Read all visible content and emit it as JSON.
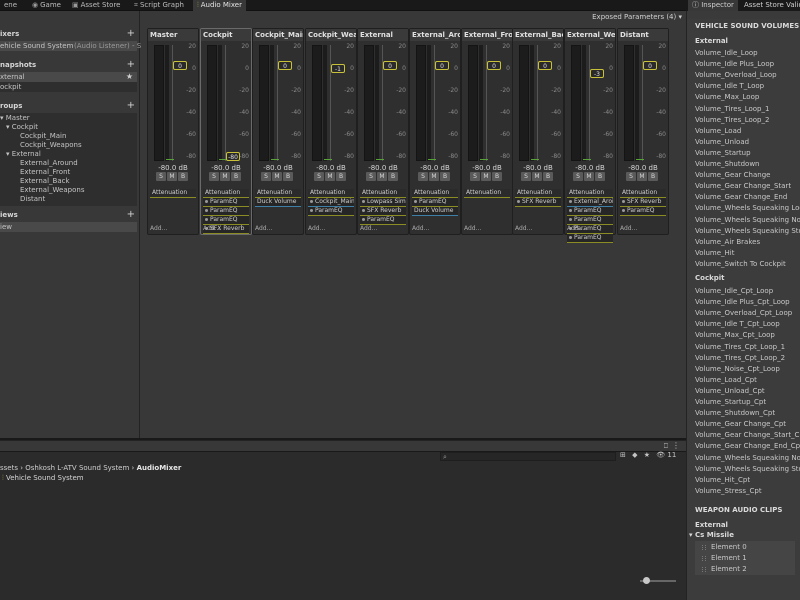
{
  "tabs": [
    {
      "label": "ene",
      "icon": ""
    },
    {
      "label": "Game",
      "icon": "gamepad-icon"
    },
    {
      "label": "Asset Store",
      "icon": "store-icon"
    },
    {
      "label": "Script Graph",
      "icon": "graph-icon"
    },
    {
      "label": "Audio Mixer",
      "icon": "audio-mixer-icon"
    }
  ],
  "right_tabs": [
    {
      "label": "Inspector",
      "icon": "info-icon"
    },
    {
      "label": "Asset Store Validat"
    }
  ],
  "exposed_parameters": "Exposed Parameters (4)",
  "left": {
    "mixers_title": "ixers",
    "mixer_name": "ehicle Sound System",
    "mixer_listener": "(Audio Listener) - S",
    "snapshots_title": "napshots",
    "snapshots": [
      "xternal",
      "ockpit"
    ],
    "groups_title": "roups",
    "groups": [
      {
        "label": "Master",
        "indent": 0
      },
      {
        "label": "Cockpit",
        "indent": 1
      },
      {
        "label": "Cockpit_Main",
        "indent": 2
      },
      {
        "label": "Cockpit_Weapons",
        "indent": 2
      },
      {
        "label": "External",
        "indent": 1
      },
      {
        "label": "External_Around",
        "indent": 2
      },
      {
        "label": "External_Front",
        "indent": 2
      },
      {
        "label": "External_Back",
        "indent": 2
      },
      {
        "label": "External_Weapons",
        "indent": 2
      },
      {
        "label": "Distant",
        "indent": 2
      }
    ],
    "views_title": "iews",
    "views": [
      "iew"
    ]
  },
  "strips": [
    {
      "name": "Master",
      "db": "-80.0 dB",
      "fader": "0",
      "effects": [
        {
          "label": "Attenuation",
          "type": "head"
        }
      ]
    },
    {
      "name": "Cockpit",
      "db": "-80.0 dB",
      "fader": "-80",
      "effects": [
        {
          "label": "Attenuation",
          "type": "head"
        },
        {
          "label": "ParamEQ",
          "type": "dot"
        },
        {
          "label": "ParamEQ",
          "type": "dot"
        },
        {
          "label": "ParamEQ",
          "type": "dot"
        },
        {
          "label": "SFX Reverb",
          "type": "dot"
        }
      ]
    },
    {
      "name": "Cockpit_Main",
      "db": "-80.0 dB",
      "fader": "0",
      "effects": [
        {
          "label": "Attenuation",
          "type": "head"
        },
        {
          "label": "Duck Volume",
          "type": "blue"
        }
      ]
    },
    {
      "name": "Cockpit_Weap",
      "db": "-80.0 dB",
      "fader": "-1",
      "effects": [
        {
          "label": "Attenuation",
          "type": "head"
        },
        {
          "label": "Cockpit_Main",
          "type": "dotblue"
        },
        {
          "label": "ParamEQ",
          "type": "dot"
        }
      ]
    },
    {
      "name": "External",
      "db": "-80.0 dB",
      "fader": "0",
      "effects": [
        {
          "label": "Attenuation",
          "type": "head"
        },
        {
          "label": "Lowpass Sim",
          "type": "dot"
        },
        {
          "label": "SFX Reverb",
          "type": "dot"
        },
        {
          "label": "ParamEQ",
          "type": "dot"
        }
      ]
    },
    {
      "name": "External_Arou",
      "db": "-80.0 dB",
      "fader": "0",
      "effects": [
        {
          "label": "Attenuation",
          "type": "head"
        },
        {
          "label": "ParamEQ",
          "type": "dot"
        },
        {
          "label": "Duck Volume",
          "type": "blue"
        }
      ]
    },
    {
      "name": "External_Fron",
      "db": "-80.0 dB",
      "fader": "0",
      "effects": [
        {
          "label": "Attenuation",
          "type": "head"
        }
      ]
    },
    {
      "name": "External_Back",
      "db": "-80.0 dB",
      "fader": "0",
      "effects": [
        {
          "label": "Attenuation",
          "type": "head"
        },
        {
          "label": "SFX Reverb",
          "type": "dot"
        }
      ]
    },
    {
      "name": "External_Wea",
      "db": "-80.0 dB",
      "fader": "-3",
      "effects": [
        {
          "label": "Attenuation",
          "type": "head"
        },
        {
          "label": "External_Aroi",
          "type": "dotblue"
        },
        {
          "label": "ParamEQ",
          "type": "dot"
        },
        {
          "label": "ParamEQ",
          "type": "dot"
        },
        {
          "label": "ParamEQ",
          "type": "dot"
        },
        {
          "label": "ParamEQ",
          "type": "dot"
        }
      ]
    },
    {
      "name": "Distant",
      "db": "-80.0 dB",
      "fader": "0",
      "effects": [
        {
          "label": "Attenuation",
          "type": "head"
        },
        {
          "label": "SFX Reverb",
          "type": "dot"
        },
        {
          "label": "ParamEQ",
          "type": "dot"
        }
      ]
    }
  ],
  "scale_labels": [
    "20",
    "0",
    "-20",
    "-40",
    "-60",
    "-80"
  ],
  "sms_labels": [
    "S",
    "M",
    "B"
  ],
  "add_label": "Add...",
  "bottom": {
    "count": "11",
    "breadcrumb": [
      "ssets",
      "Oshkosh L-ATV Sound System",
      "AudioMixer"
    ],
    "item": "Vehicle Sound System"
  },
  "inspector": {
    "section1_title": "VEHICLE SOUND VOLUMES",
    "external_title": "External",
    "external": [
      "Volume_Idle_Loop",
      "Volume_Idle Plus_Loop",
      "Volume_Overload_Loop",
      "Volume_Idle T_Loop",
      "Volume_Max_Loop",
      "Volume_Tires_Loop_1",
      "Volume_Tires_Loop_2",
      "Volume_Load",
      "Volume_Unload",
      "Volume_Startup",
      "Volume_Shutdown",
      "Volume_Gear Change",
      "Volume_Gear Change_Start",
      "Volume_Gear Change_End",
      "Volume_Wheels Squeaking Loop",
      "Volume_Wheels Squeaking Noise",
      "Volume_Wheels Squeaking Stop",
      "Volume_Air Brakes",
      "Volume_Hit",
      "Volume_Switch To Cockpit"
    ],
    "cockpit_title": "Cockpit",
    "cockpit": [
      "Volume_Idle_Cpt_Loop",
      "Volume_Idle Plus_Cpt_Loop",
      "Volume_Overload_Cpt_Loop",
      "Volume_Idle T_Cpt_Loop",
      "Volume_Max_Cpt_Loop",
      "Volume_Tires_Cpt_Loop_1",
      "Volume_Tires_Cpt_Loop_2",
      "Volume_Noise_Cpt_Loop",
      "Volume_Load_Cpt",
      "Volume_Unload_Cpt",
      "Volume_Startup_Cpt",
      "Volume_Shutdown_Cpt",
      "Volume_Gear Change_Cpt",
      "Volume_Gear Change_Start_Cpt",
      "Volume_Gear Change_End_Cpt",
      "Volume_Wheels Squeaking Noise",
      "Volume_Wheels Squeaking Stop_",
      "Volume_Hit_Cpt",
      "Volume_Stress_Cpt"
    ],
    "section2_title": "WEAPON AUDIO CLIPS",
    "weapon_external_title": "External",
    "missile_title": "Cs Missile",
    "elements": [
      "Element 0",
      "Element 1",
      "Element 2"
    ]
  }
}
